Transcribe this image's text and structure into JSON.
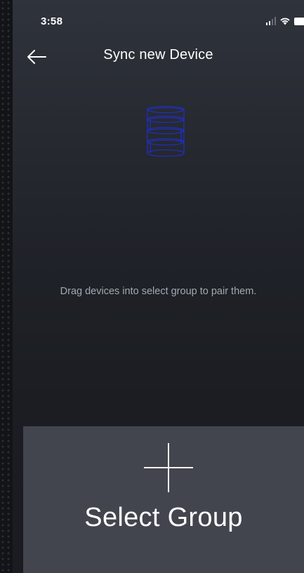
{
  "status_bar": {
    "time": "3:58",
    "icons": [
      "signal-icon",
      "wifi-icon",
      "battery-icon"
    ]
  },
  "header": {
    "back_icon": "arrow-left-icon",
    "title": "Sync new Device"
  },
  "main": {
    "illustration": "spiral-sync-icon",
    "instruction": "Drag devices into select group to pair them."
  },
  "select_group": {
    "icon": "plus-icon",
    "label": "Select Group"
  },
  "colors": {
    "background": "#1f2228",
    "panel": "#42454d",
    "spiral": "#1f2fd6",
    "text_primary": "#ffffff",
    "text_secondary": "#a4a8b0"
  }
}
